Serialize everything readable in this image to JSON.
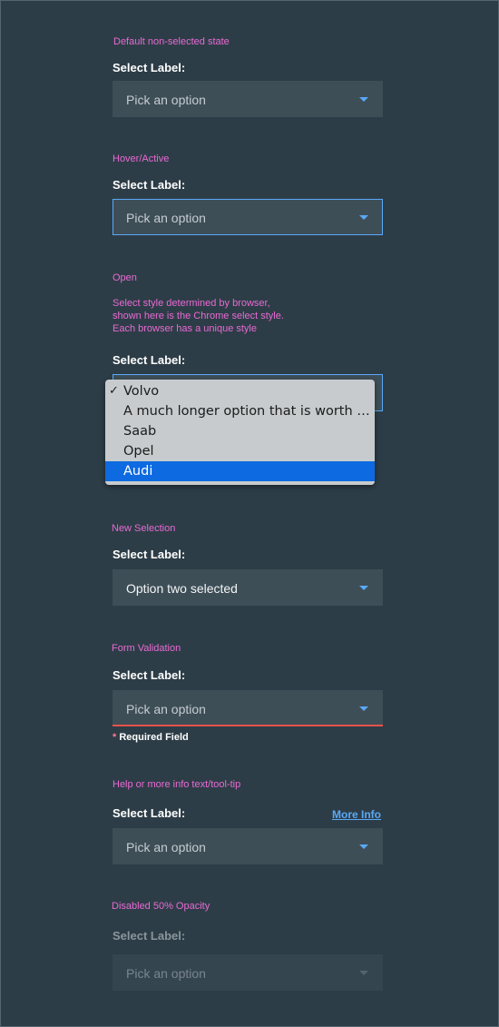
{
  "sections": {
    "default": {
      "caption": "Default non-selected state",
      "label": "Select Label:",
      "value": "Pick an option"
    },
    "hover": {
      "caption": "Hover/Active",
      "label": "Select Label:",
      "value": "Pick an option"
    },
    "open": {
      "caption": "Open",
      "note_lines": [
        "Select style determined by browser,",
        "shown here is the Chrome select style.",
        "Each browser has a unique style"
      ],
      "label": "Select Label:",
      "options": [
        "Volvo",
        "A much longer option that is worth having around to check how text flows",
        "Saab",
        "Opel",
        "Audi"
      ],
      "checked_option": "Volvo",
      "highlighted_option": "Audi",
      "check_mark": "✓"
    },
    "new_selection": {
      "caption": "New Selection",
      "label": "Select Label:",
      "value": "Option two selected"
    },
    "validation": {
      "caption": "Form Validation",
      "label": "Select Label:",
      "value": "Pick an option",
      "error_star": "*",
      "error_text": "Required Field"
    },
    "help": {
      "caption": "Help or more info text/tool-tip",
      "label": "Select Label:",
      "value": "Pick an option",
      "link": "More Info"
    },
    "disabled": {
      "caption": "Disabled 50% Opacity",
      "label": "Select Label:",
      "value": "Pick an option"
    }
  },
  "colors": {
    "background": "#2d3d47",
    "field": "#3e4e57",
    "caption": "#e96ad4",
    "accent": "#5aa8f6",
    "error": "#e8524a",
    "highlight": "#0d6ae0"
  },
  "icons": {
    "caret": "chevron-down-icon",
    "check": "check-icon"
  }
}
